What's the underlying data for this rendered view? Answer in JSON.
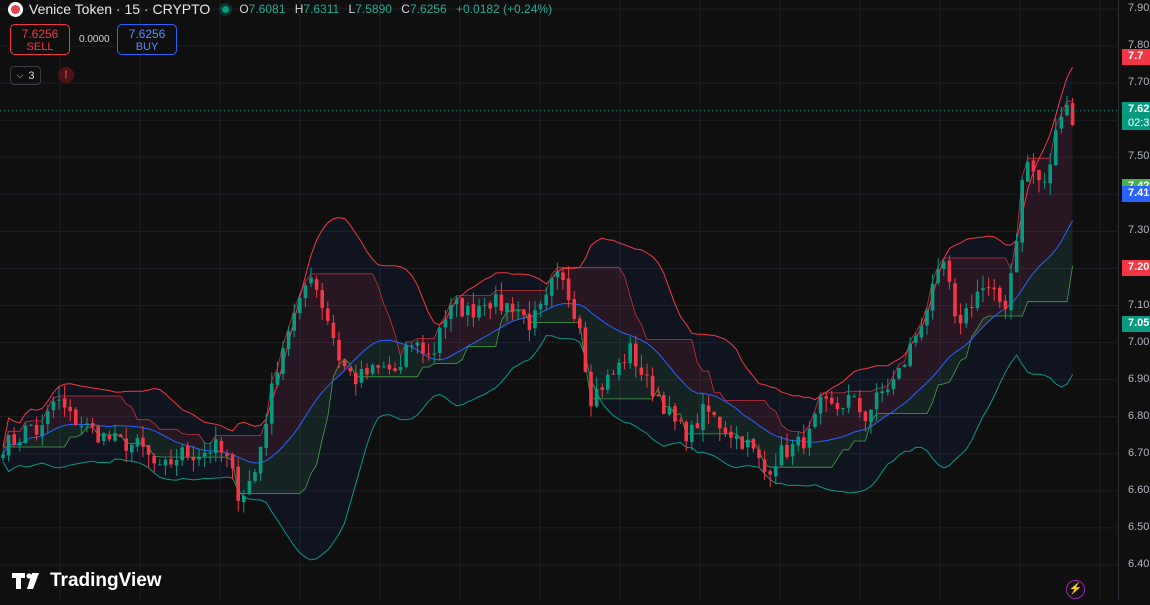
{
  "header": {
    "symbol": "Venice Token · 15 · CRYPTO",
    "open_label": "O",
    "open": "7.6081",
    "high_label": "H",
    "high": "7.6311",
    "low_label": "L",
    "low": "7.5890",
    "close_label": "C",
    "close": "7.6256",
    "change": "+0.0182 (+0.24%)"
  },
  "trade": {
    "sell_price": "7.6256",
    "sell_label": "SELL",
    "buy_price": "7.6256",
    "buy_label": "BUY",
    "spread": "0.0000"
  },
  "indicator_count": "3",
  "warning_glyph": "!",
  "brand": "TradingView",
  "colors": {
    "up": "#089981",
    "down": "#f23645",
    "basis": "#2962ff",
    "upper_band": "#f23645",
    "lower_band": "#089981",
    "inner_upper": "#f23645",
    "inner_lower": "#4caf50"
  },
  "axis_labels": [
    {
      "label": "7.7",
      "value": 7.77,
      "color": "#f23645"
    },
    {
      "label": "7.62",
      "sub": "02:3",
      "value": 7.6256,
      "color": "#089981"
    },
    {
      "label": "7.42",
      "value": 7.42,
      "color": "#4caf50"
    },
    {
      "label": "7.41",
      "value": 7.4,
      "color": "#2962ff"
    },
    {
      "label": "7.20",
      "value": 7.2,
      "color": "#f23645"
    },
    {
      "label": "7.05",
      "value": 7.05,
      "color": "#089981"
    }
  ],
  "chart_data": {
    "type": "candlestick",
    "y_ticks": [
      "7.90",
      "7.80",
      "7.70",
      "7.60",
      "7.50",
      "7.40",
      "7.30",
      "7.20",
      "7.10",
      "7.00",
      "6.90",
      "6.80",
      "6.70",
      "6.60",
      "6.50",
      "6.40"
    ],
    "ylim": [
      6.3,
      7.92
    ],
    "last_price": 7.6256,
    "grid": true,
    "anchors": [
      [
        0,
        6.72
      ],
      [
        18,
        6.74
      ],
      [
        30,
        6.78
      ],
      [
        40,
        6.75
      ],
      [
        55,
        6.85
      ],
      [
        70,
        6.8
      ],
      [
        88,
        6.77
      ],
      [
        100,
        6.75
      ],
      [
        120,
        6.73
      ],
      [
        140,
        6.72
      ],
      [
        160,
        6.65
      ],
      [
        180,
        6.7
      ],
      [
        200,
        6.7
      ],
      [
        215,
        6.72
      ],
      [
        228,
        6.68
      ],
      [
        240,
        6.58
      ],
      [
        255,
        6.65
      ],
      [
        265,
        6.78
      ],
      [
        278,
        6.95
      ],
      [
        290,
        7.05
      ],
      [
        300,
        7.1
      ],
      [
        310,
        7.2
      ],
      [
        320,
        7.12
      ],
      [
        330,
        7.05
      ],
      [
        340,
        6.95
      ],
      [
        355,
        6.9
      ],
      [
        370,
        6.92
      ],
      [
        385,
        6.93
      ],
      [
        400,
        6.92
      ],
      [
        410,
        7.0
      ],
      [
        425,
        6.98
      ],
      [
        432,
        6.95
      ],
      [
        440,
        7.05
      ],
      [
        455,
        7.1
      ],
      [
        470,
        7.08
      ],
      [
        485,
        7.12
      ],
      [
        500,
        7.1
      ],
      [
        515,
        7.1
      ],
      [
        530,
        7.05
      ],
      [
        545,
        7.1
      ],
      [
        555,
        7.18
      ],
      [
        565,
        7.15
      ],
      [
        580,
        7.05
      ],
      [
        590,
        6.85
      ],
      [
        600,
        6.88
      ],
      [
        615,
        6.92
      ],
      [
        630,
        6.98
      ],
      [
        645,
        6.9
      ],
      [
        660,
        6.85
      ],
      [
        675,
        6.78
      ],
      [
        690,
        6.75
      ],
      [
        705,
        6.82
      ],
      [
        720,
        6.78
      ],
      [
        735,
        6.75
      ],
      [
        750,
        6.72
      ],
      [
        765,
        6.65
      ],
      [
        780,
        6.7
      ],
      [
        795,
        6.72
      ],
      [
        810,
        6.75
      ],
      [
        820,
        6.83
      ],
      [
        835,
        6.82
      ],
      [
        850,
        6.85
      ],
      [
        865,
        6.8
      ],
      [
        880,
        6.86
      ],
      [
        895,
        6.9
      ],
      [
        905,
        6.95
      ],
      [
        920,
        7.05
      ],
      [
        935,
        7.15
      ],
      [
        945,
        7.22
      ],
      [
        955,
        7.05
      ],
      [
        965,
        7.08
      ],
      [
        980,
        7.15
      ],
      [
        995,
        7.12
      ],
      [
        1005,
        7.1
      ],
      [
        1015,
        7.25
      ],
      [
        1025,
        7.5
      ],
      [
        1035,
        7.45
      ],
      [
        1045,
        7.42
      ],
      [
        1055,
        7.55
      ],
      [
        1065,
        7.68
      ],
      [
        1072,
        7.58
      ],
      [
        1077,
        7.62
      ]
    ]
  }
}
